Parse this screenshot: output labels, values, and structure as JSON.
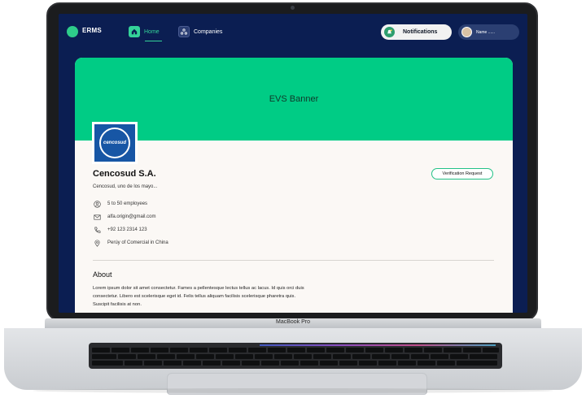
{
  "nav": {
    "logo": "ERMS",
    "home": "Home",
    "companies": "Companies",
    "notifications": "Notifications",
    "user": "Name ......"
  },
  "banner": {
    "title": "EVS Banner"
  },
  "company": {
    "logo_text": "cencosud",
    "name": "Cencosud S.A.",
    "description": "Cencosud, uno de los mayo...",
    "verify_label": "Verification Request",
    "employees": "5 to 50 employees",
    "email": "alfa.origin@gmail.com",
    "phone": "+92 123 2314 123",
    "location": "Perúy of Comercial in China"
  },
  "about": {
    "title": "About",
    "text": "Lorem ipsum dolor sit amet consectetur. Fames a pellentesque lectus tellus ac lacus. Id quis orci duis consectetur. Libero est scelerisque eget id. Felis tellus aliquam facilisis scelerisque pharetra quis. Suscipit facilisis at non."
  },
  "device": {
    "brand": "MacBook Pro"
  },
  "colors": {
    "navy": "#0b1e52",
    "accent": "#00cc85",
    "card": "#fbf8f5"
  }
}
